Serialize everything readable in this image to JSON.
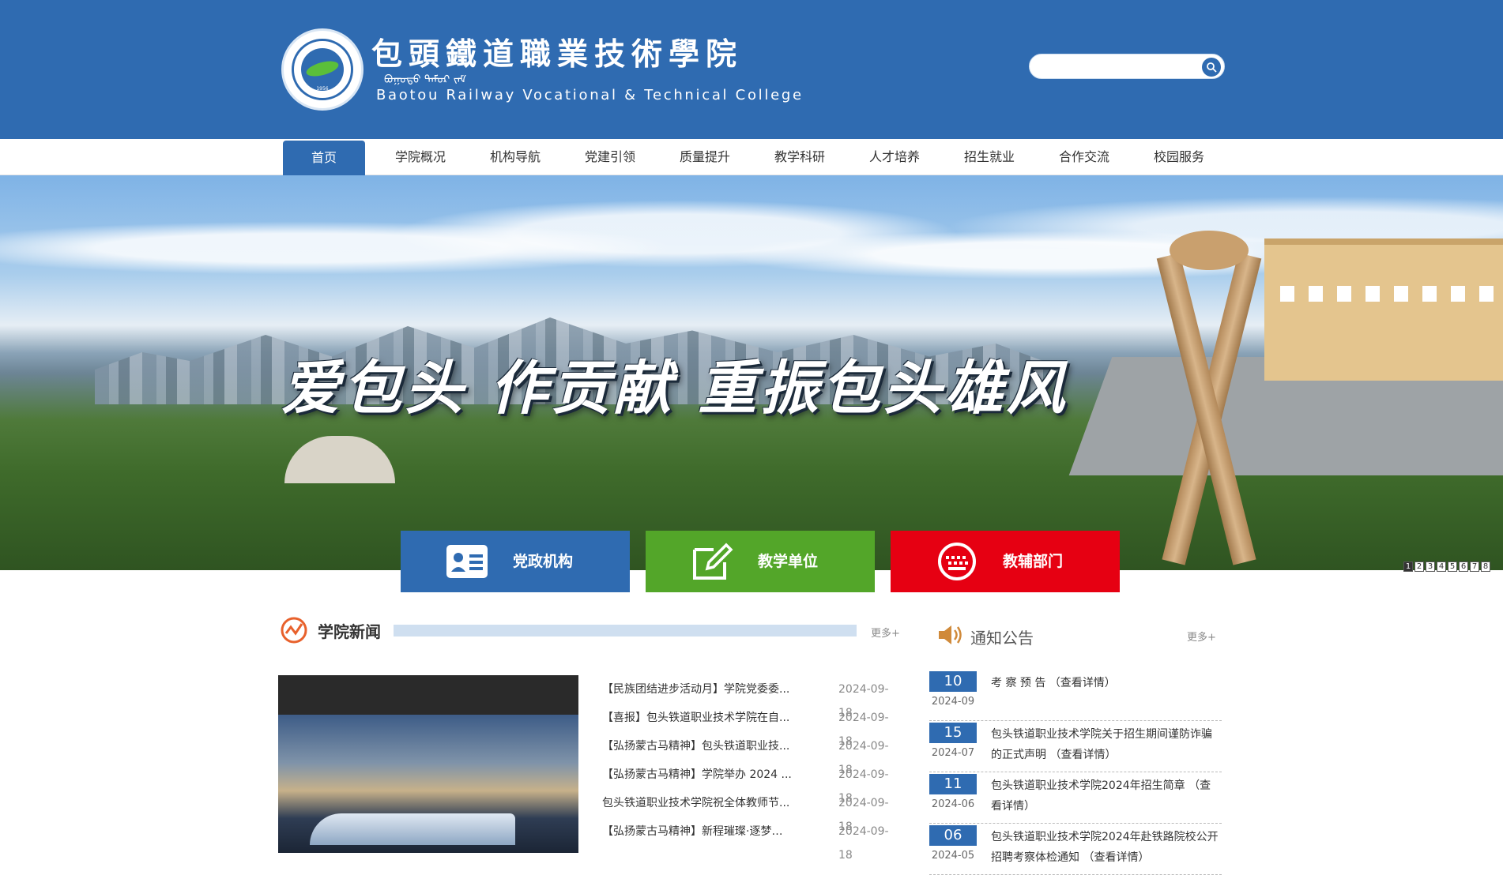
{
  "header": {
    "logo_year": "1956",
    "logo_cn": "包頭鐵道職業技術學院",
    "logo_mn": "ᠪᠤᠭᠤᠲᠤ ᠲᠡᠮᠦᠷ ᠵᠠᠮ",
    "logo_en": "Baotou Railway Vocational & Technical College",
    "search_placeholder": "",
    "search_value": ""
  },
  "nav": {
    "items": [
      {
        "label": "首页",
        "active": true
      },
      {
        "label": "学院概况"
      },
      {
        "label": "机构导航"
      },
      {
        "label": "党建引领"
      },
      {
        "label": "质量提升"
      },
      {
        "label": "教学科研"
      },
      {
        "label": "人才培养"
      },
      {
        "label": "招生就业"
      },
      {
        "label": "合作交流"
      },
      {
        "label": "校园服务"
      }
    ]
  },
  "banner": {
    "slogan": "爱包头 作贡献 重振包头雄风",
    "slides": [
      "1",
      "2",
      "3",
      "4",
      "5",
      "6",
      "7",
      "8"
    ],
    "active_slide": 1
  },
  "quick_links": [
    {
      "label": "党政机构",
      "icon": "id-card-icon",
      "color": "#2f6bb1"
    },
    {
      "label": "教学单位",
      "icon": "edit-icon",
      "color": "#53a629"
    },
    {
      "label": "教辅部门",
      "icon": "keyboard-icon",
      "color": "#e60012"
    }
  ],
  "news": {
    "title": "学院新闻",
    "more": "更多+",
    "items": [
      {
        "title": "【民族团结进步活动月】学院党委委...",
        "date": "2024-09-18"
      },
      {
        "title": "【喜报】包头铁道职业技术学院在自...",
        "date": "2024-09-18"
      },
      {
        "title": "【弘扬蒙古马精神】包头铁道职业技...",
        "date": "2024-09-18"
      },
      {
        "title": "【弘扬蒙古马精神】学院举办 2024 ...",
        "date": "2024-09-18"
      },
      {
        "title": "包头铁道职业技术学院祝全体教师节...",
        "date": "2024-09-18"
      },
      {
        "title": "【弘扬蒙古马精神】新程璀璨·逐梦芳...",
        "date": "2024-09-18"
      }
    ]
  },
  "notice": {
    "title": "通知公告",
    "more": "更多+",
    "items": [
      {
        "day": "10",
        "month": "2024-09",
        "text": "考 察 预 告 （查看详情）"
      },
      {
        "day": "15",
        "month": "2024-07",
        "text": "包头铁道职业技术学院关于招生期间谨防诈骗的正式声明 （查看详情）"
      },
      {
        "day": "11",
        "month": "2024-06",
        "text": "包头铁道职业技术学院2024年招生简章 （查看详情）"
      },
      {
        "day": "06",
        "month": "2024-05",
        "text": "包头铁道职业技术学院2024年赴铁路院校公开招聘考察体检通知 （查看详情）"
      }
    ]
  },
  "colors": {
    "brand_blue": "#2f6bb1",
    "green": "#53a629",
    "red": "#e60012"
  }
}
